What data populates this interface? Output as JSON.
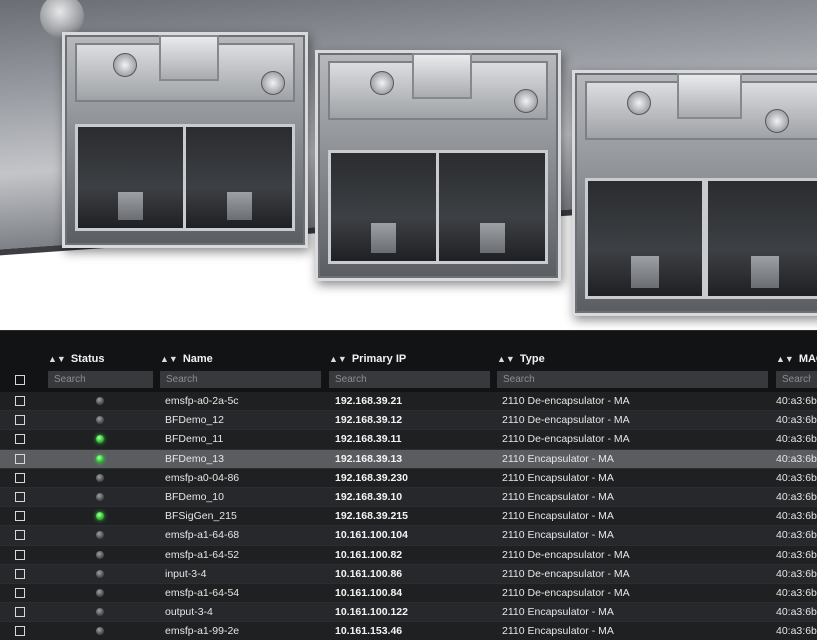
{
  "table": {
    "columns": [
      {
        "key": "status",
        "label": "Status"
      },
      {
        "key": "name",
        "label": "Name"
      },
      {
        "key": "ip",
        "label": "Primary IP"
      },
      {
        "key": "type",
        "label": "Type"
      },
      {
        "key": "mac",
        "label": "MAC"
      }
    ],
    "search_placeholder": "Search",
    "rows": [
      {
        "status": "off",
        "name": "emsfp-a0-2a-5c",
        "ip": "192.168.39.21",
        "type": "2110 De-encapsulator - MA",
        "mac": "40:a3:6b"
      },
      {
        "status": "off",
        "name": "BFDemo_12",
        "ip": "192.168.39.12",
        "type": "2110 De-encapsulator - MA",
        "mac": "40:a3:6b"
      },
      {
        "status": "on",
        "name": "BFDemo_11",
        "ip": "192.168.39.11",
        "type": "2110 De-encapsulator - MA",
        "mac": "40:a3:6b"
      },
      {
        "status": "on",
        "name": "BFDemo_13",
        "ip": "192.168.39.13",
        "type": "2110 Encapsulator - MA",
        "mac": "40:a3:6b",
        "selected": true
      },
      {
        "status": "off",
        "name": "emsfp-a0-04-86",
        "ip": "192.168.39.230",
        "type": "2110 Encapsulator - MA",
        "mac": "40:a3:6b"
      },
      {
        "status": "off",
        "name": "BFDemo_10",
        "ip": "192.168.39.10",
        "type": "2110 Encapsulator - MA",
        "mac": "40:a3:6b"
      },
      {
        "status": "on",
        "name": "BFSigGen_215",
        "ip": "192.168.39.215",
        "type": "2110 Encapsulator - MA",
        "mac": "40:a3:6b"
      },
      {
        "status": "off",
        "name": "emsfp-a1-64-68",
        "ip": "10.161.100.104",
        "type": "2110 Encapsulator - MA",
        "mac": "40:a3:6b"
      },
      {
        "status": "off",
        "name": "emsfp-a1-64-52",
        "ip": "10.161.100.82",
        "type": "2110 De-encapsulator - MA",
        "mac": "40:a3:6b"
      },
      {
        "status": "off",
        "name": "input-3-4",
        "ip": "10.161.100.86",
        "type": "2110 De-encapsulator - MA",
        "mac": "40:a3:6b"
      },
      {
        "status": "off",
        "name": "emsfp-a1-64-54",
        "ip": "10.161.100.84",
        "type": "2110 De-encapsulator - MA",
        "mac": "40:a3:6b"
      },
      {
        "status": "off",
        "name": "output-3-4",
        "ip": "10.161.100.122",
        "type": "2110 Encapsulator - MA",
        "mac": "40:a3:6b"
      },
      {
        "status": "off",
        "name": "emsfp-a1-99-2e",
        "ip": "10.161.153.46",
        "type": "2110 Encapsulator - MA",
        "mac": "40:a3:6b"
      }
    ]
  },
  "colors": {
    "led_on": "#3ed13e",
    "led_off": "#4c4e51",
    "selected_row": "#5a5c5f",
    "header_bg": "#121315"
  }
}
